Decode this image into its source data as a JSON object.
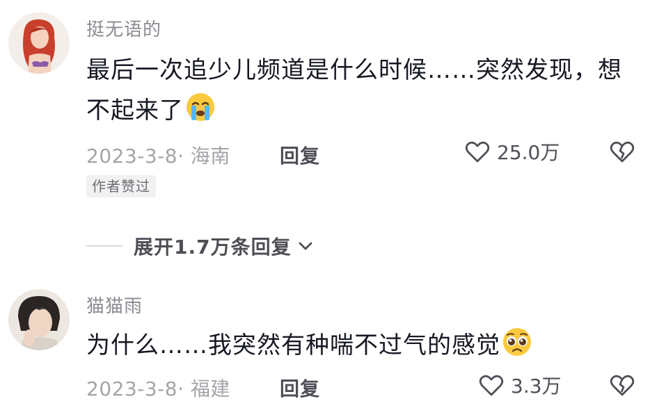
{
  "comments": [
    {
      "username": "挺无语的",
      "text": "最后一次追少儿频道是什么时候……突然发现，想不起来了",
      "emoji": "crying-face-emoji",
      "date": "2023-3-8",
      "location": "海南",
      "reply_label": "回复",
      "likes": "25.0万",
      "badge": "作者赞过"
    },
    {
      "username": "猫猫雨",
      "text": "为什么……我突然有种喘不过气的感觉",
      "emoji": "pleading-face-emoji",
      "date": "2023-3-8",
      "location": "福建",
      "reply_label": "回复",
      "likes": "3.3万"
    }
  ],
  "expand_replies": "展开1.7万条回复",
  "colors": {
    "primary_text": "#161823",
    "secondary_text": "#a3a4a8",
    "action_text": "#4e4f56"
  }
}
